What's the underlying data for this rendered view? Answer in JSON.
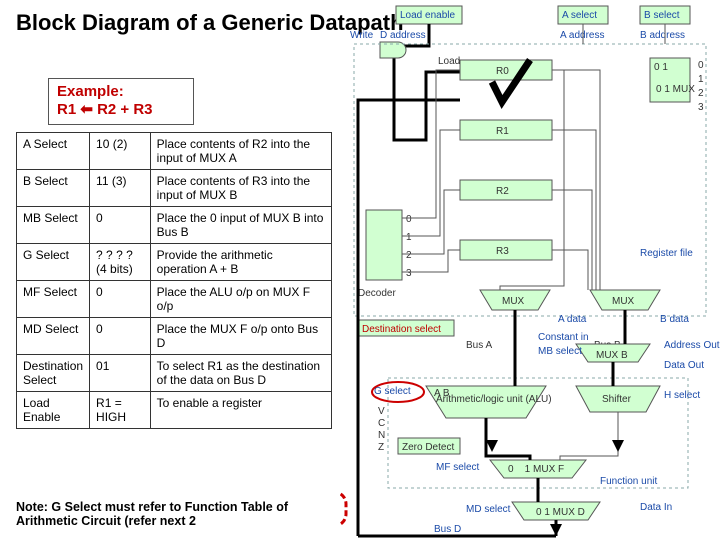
{
  "title": "Block Diagram of a Generic Datapath",
  "example": {
    "label": "Example:",
    "eq": "R1 ⬅ R2 + R3"
  },
  "table": {
    "rows": [
      {
        "sel": "A Select",
        "val": "10 (2)",
        "desc": "Place contents of R2 into the input of MUX A"
      },
      {
        "sel": "B Select",
        "val": "11 (3)",
        "desc": "Place contents of R3 into the input of MUX B"
      },
      {
        "sel": "MB Select",
        "val": "0",
        "desc": "Place the 0 input of MUX B into Bus B"
      },
      {
        "sel": "G Select",
        "val": "? ? ? ? (4 bits)",
        "desc": "Provide the arithmetic operation A + B"
      },
      {
        "sel": "MF Select",
        "val": "0",
        "desc": "Place the ALU o/p on MUX F o/p"
      },
      {
        "sel": "MD Select",
        "val": "0",
        "desc": "Place the MUX F o/p onto Bus D"
      },
      {
        "sel": "Destination Select",
        "val": "01",
        "desc": "To select R1 as the destination of the data on Bus D"
      },
      {
        "sel": "Load Enable",
        "val": "R1 = HIGH",
        "desc": "To enable a register"
      }
    ]
  },
  "note": "Note: G Select must refer to Function Table of Arithmetic Circuit (refer next 2",
  "diagram": {
    "top": {
      "load_enable": "Load enable",
      "write": "Write",
      "a_select": "A select",
      "b_select": "B select",
      "d_addr": "D address",
      "a_addr": "A address",
      "b_addr": "B address"
    },
    "decoder": "Decoder",
    "registers": [
      "R0",
      "R1",
      "R2",
      "R3"
    ],
    "mux01": "0 1\nMUX",
    "mux_left": "MUX",
    "mux_right": "MUX",
    "reg_file": "Register file",
    "a_data": "A data",
    "b_data": "B data",
    "dest_sel": "Destination select",
    "bus_a": "Bus A",
    "bus_b": "Bus B",
    "mux_b": "MUX B",
    "addr_out": "Address Out",
    "data_out": "Data Out",
    "g_sel": "G select",
    "h_sel": "H select",
    "alu": "Arithmetic/logic unit (ALU)",
    "shifter": "Shifter",
    "sig": {
      "v": "V",
      "c": "C",
      "n": "N",
      "z": "Z"
    },
    "zero": "Zero Detect",
    "mux_f": "0    1\nMUX F",
    "mf_sel": "MF select",
    "fn_unit": "Function unit",
    "mux_d": "0 1\nMUX D",
    "data_in": "Data In",
    "md_sel": "MD select",
    "bus_d": "Bus D",
    "mini": [
      "0",
      "1",
      "2",
      "3"
    ],
    "constant_in": "Constant in",
    "mb_sel": "MB select",
    "load": "Load"
  }
}
